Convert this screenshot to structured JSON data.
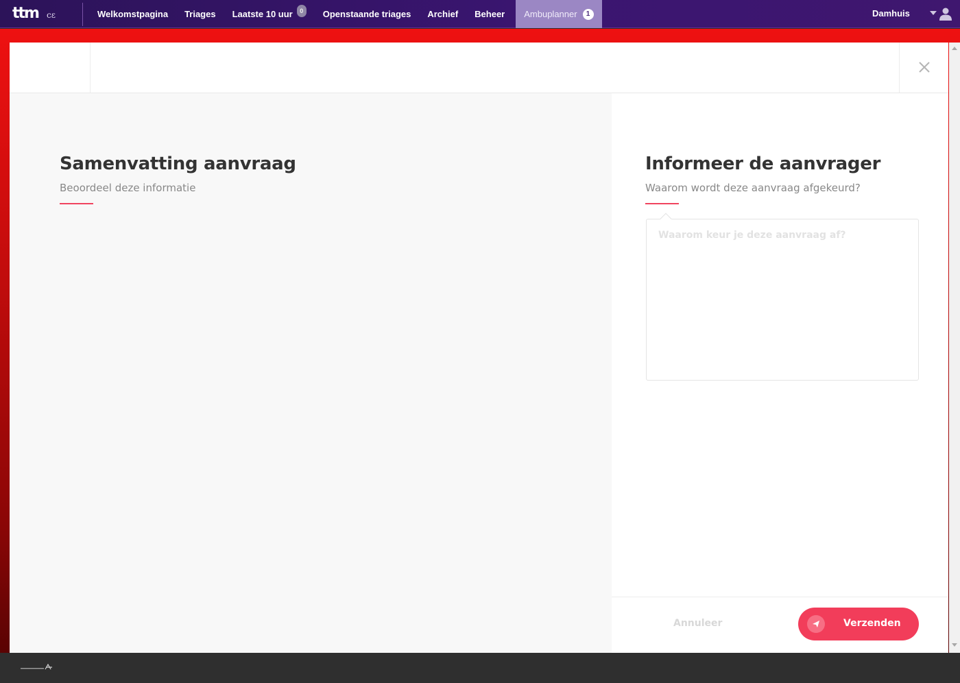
{
  "app": {
    "logo_text": "ttm",
    "logo_mark": "cε"
  },
  "nav": {
    "items": [
      {
        "label": "Welkomstpagina"
      },
      {
        "label": "Triages"
      },
      {
        "label": "Laatste 10 uur",
        "badge": "0"
      },
      {
        "label": "Openstaande triages"
      },
      {
        "label": "Archief"
      },
      {
        "label": "Beheer"
      },
      {
        "label": "Ambuplanner",
        "badge": "1",
        "active": true
      }
    ]
  },
  "user": {
    "name": "Damhuis",
    "icon": "user-icon"
  },
  "modal": {
    "close_icon": "close-icon",
    "summary": {
      "title": "Samenvatting aanvraag",
      "subtitle": "Beoordeel deze informatie"
    },
    "inform": {
      "title": "Informeer de aanvrager",
      "subtitle": "Waarom wordt deze aanvraag afgekeurd?",
      "reason_placeholder": "Waarom keur je deze aanvraag af?",
      "reason_value": ""
    },
    "actions": {
      "cancel_label": "Annuleer",
      "send_label": "Verzenden",
      "send_icon": "paper-plane-icon"
    }
  },
  "colors": {
    "nav_bg": "#3a1570",
    "nav_active_bg": "#9b87c4",
    "accent": "#f23d5a",
    "backdrop": "#e11111"
  }
}
